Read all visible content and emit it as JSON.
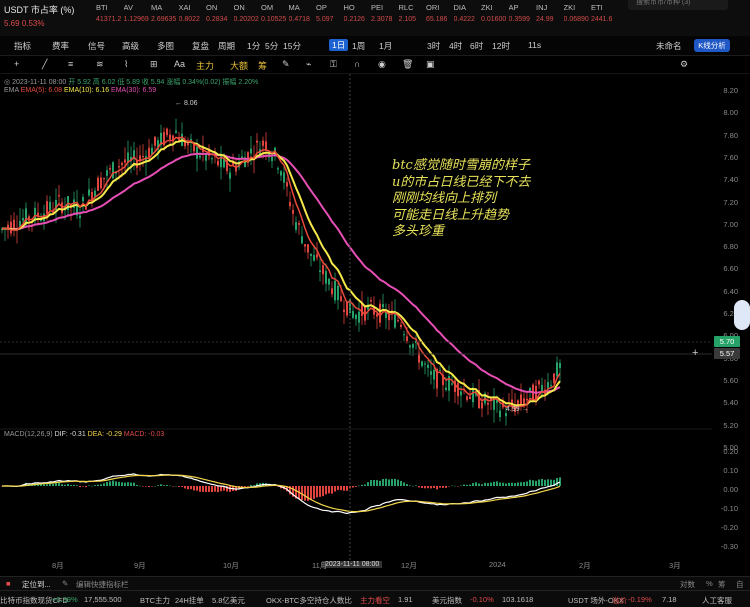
{
  "ticker_bar": {
    "pair_name": "USDT 市占率 (%)",
    "pair_price": "5.69",
    "pair_change": "0.53%",
    "search_placeholder": "搜索币币/币种 (3)",
    "items": [
      {
        "name": "BTI",
        "value": "41371.2",
        "dir": "down"
      },
      {
        "name": "AV",
        "value": "1.12969",
        "dir": "down"
      },
      {
        "name": "MA",
        "value": "2.69635",
        "dir": "down"
      },
      {
        "name": "XAI",
        "value": "0.8022",
        "dir": "down"
      },
      {
        "name": "ON",
        "value": "0.2834",
        "dir": "down"
      },
      {
        "name": "ON",
        "value": "0.20202",
        "dir": "down"
      },
      {
        "name": "OM",
        "value": "0.10525",
        "dir": "down"
      },
      {
        "name": "MA",
        "value": "0.4718",
        "dir": "down"
      },
      {
        "name": "OP",
        "value": "5.097",
        "dir": "down"
      },
      {
        "name": "HO",
        "value": "0.2126",
        "dir": "down"
      },
      {
        "name": "PEI",
        "value": "2.3078",
        "dir": "down"
      },
      {
        "name": "RLC",
        "value": "2.105",
        "dir": "down"
      },
      {
        "name": "ORI",
        "value": "65.186",
        "dir": "down"
      },
      {
        "name": "DIA",
        "value": "0.4222",
        "dir": "down"
      },
      {
        "name": "ZKI",
        "value": "0.01600",
        "dir": "down"
      },
      {
        "name": "AP",
        "value": "0.3599",
        "dir": "down"
      },
      {
        "name": "INJ",
        "value": "24.99",
        "dir": "down"
      },
      {
        "name": "ZKI",
        "value": "0.06890",
        "dir": "down"
      },
      {
        "name": "ETI",
        "value": "2441.6",
        "dir": "down"
      }
    ]
  },
  "toolbar": {
    "indicators": "指标",
    "fee_rate": "费率",
    "signal": "信号",
    "advanced": "高级",
    "multi": "多图",
    "replay": "复盘",
    "period": "周期",
    "intervals": [
      "1分",
      "5分",
      "15分",
      "1日",
      "1周",
      "1月",
      "3时",
      "4时",
      "6时",
      "12时"
    ],
    "active_interval": "1日",
    "countdown": "11s",
    "unnamed": "未命名",
    "k_analysis": "K线分析"
  },
  "toolbar2": {
    "text_tool": "Aa",
    "main_force": "主力",
    "big_order": "大额",
    "chip": "筹"
  },
  "ohlc_legend": {
    "date": "2023-11-11 08:00",
    "open": "开 5.92",
    "high": "高 6.02",
    "low": "低 5.89",
    "close": "收 5.94",
    "change": "涨幅 0.34%(0.02)",
    "amplitude": "振幅 2.20%"
  },
  "ema_legend": {
    "label": "EMA",
    "ema5": "EMA(5): 6.08",
    "ema10": "EMA(10): 6.16",
    "ema30": "EMA(30): 6.59"
  },
  "macd_legend": {
    "label": "MACD(12,26,9)",
    "dif": "DIF: -0.31",
    "dea": "DEA: -0.29",
    "macd": "MACD: -0.03"
  },
  "annotation": [
    "btc感觉随时雪崩的样子",
    "u的市占日线已经下不去",
    "刚刚均线向上排列",
    "可能走日线上升趋势",
    "多头珍重"
  ],
  "high_marker": "8.06",
  "low_marker": "4.99",
  "crosshair_date": "2023-11-11 08:00",
  "y_axis": [
    "8.20",
    "8.00",
    "7.80",
    "7.60",
    "7.40",
    "7.20",
    "7.00",
    "6.80",
    "6.60",
    "6.40",
    "6.20",
    "6.00",
    "5.80",
    "5.60",
    "5.40",
    "5.20",
    "5.00"
  ],
  "y_axis_macd": [
    "0.20",
    "0.10",
    "0.00",
    "-0.10",
    "-0.20",
    "-0.30"
  ],
  "price_tags": {
    "current": "5.70",
    "cursor": "5.57"
  },
  "x_axis": [
    "8月",
    "9月",
    "10月",
    "11月",
    "12月",
    "2024",
    "2月",
    "3月"
  ],
  "axis_corner": {
    "c1": "对数",
    "c2": "%",
    "c3": "筹",
    "c4": "自"
  },
  "bottom_bar": {
    "locate": "定位到...",
    "shortcut": "编辑快捷指标栏"
  },
  "status_bar": {
    "item1_label": "比特币指数现货CFD",
    "item1_change": "+0.39%",
    "item1_value": "17,555.500",
    "item2_label": "BTC主力",
    "item2_sub": "24H挂单",
    "item2_value": "5.8亿美元",
    "item3_label": "OKX-BTC多空持仓人数比",
    "item3_sub": "主力看空",
    "item3_value": "1.91",
    "item4_label": "美元指数",
    "item4_change": "-0.10%",
    "item4_value": "103.1618",
    "item5_label": "USDT 场外-OKX",
    "item5_sub": "溢价",
    "item5_change": "-0.19%",
    "item5_value": "7.18",
    "service": "人工客服"
  },
  "colors": {
    "up": "#26a269",
    "down": "#e0443f",
    "ema5": "#e84b3c",
    "ema10": "#f5e84a",
    "ema30": "#e64fb5",
    "accent": "#1c62d0"
  }
}
